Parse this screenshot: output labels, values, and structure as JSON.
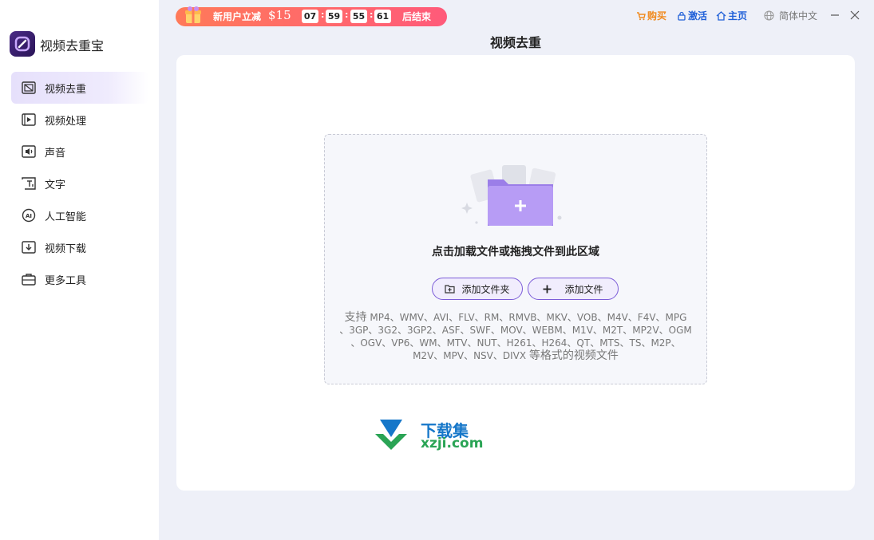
{
  "app": {
    "name": "视频去重宝"
  },
  "sidebar": {
    "items": [
      {
        "label": "视频去重",
        "icon": "video-dedupe-icon",
        "active": true
      },
      {
        "label": "视频处理",
        "icon": "video-play-icon",
        "active": false
      },
      {
        "label": "声音",
        "icon": "audio-icon",
        "active": false
      },
      {
        "label": "文字",
        "icon": "text-icon",
        "active": false
      },
      {
        "label": "人工智能",
        "icon": "ai-icon",
        "active": false
      },
      {
        "label": "视频下载",
        "icon": "download-icon",
        "active": false
      },
      {
        "label": "更多工具",
        "icon": "toolbox-icon",
        "active": false
      }
    ]
  },
  "promo": {
    "text": "新用户立减",
    "amount": "$15",
    "countdown": [
      "07",
      "59",
      "55",
      "61"
    ],
    "separator": ":",
    "end_label": "后结束"
  },
  "header": {
    "buy_label": "购买",
    "activate_label": "激活",
    "home_label": "主页",
    "language": "简体中文",
    "page_title": "视频去重"
  },
  "dropzone": {
    "title": "点击加载文件或拖拽文件到此区域",
    "add_folder_label": "添加文件夹",
    "add_file_label": "添加文件",
    "formats_prefix": "支持",
    "formats_line1": "MP4、WMV、AVI、FLV、RM、RMVB、MKV、VOB、M4V、F4V、MPG",
    "formats_line2": "、3GP、3G2、3GP2、ASF、SWF、MOV、WEBM、M1V、M2T、MP2V、OGM",
    "formats_line3": "、OGV、VP6、WM、MTV、NUT、H261、H264、QT、MTS、TS、M2P、",
    "formats_line4": "M2V、MPV、NSV、DIVX",
    "formats_suffix": "等格式的视频文件"
  },
  "watermark": {
    "line1": "下载集",
    "line2": "xzji.com"
  },
  "colors": {
    "accent": "#7c5cd8",
    "promo_start": "#ff7a59",
    "promo_end": "#ff5a7a",
    "link_orange": "#f08a1e",
    "link_blue": "#2060d8"
  }
}
